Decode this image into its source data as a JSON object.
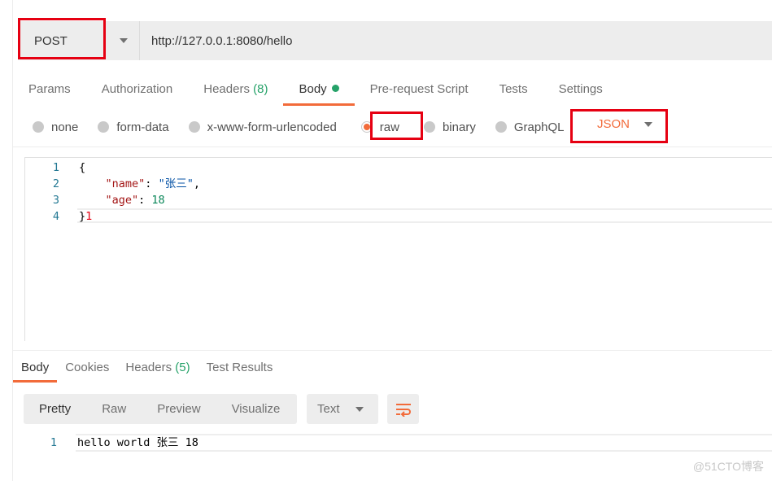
{
  "request": {
    "method": "POST",
    "url": "http://127.0.0.1:8080/hello"
  },
  "tabs": [
    {
      "label": "Params"
    },
    {
      "label": "Authorization"
    },
    {
      "label": "Headers",
      "count": "(8)"
    },
    {
      "label": "Body"
    },
    {
      "label": "Pre-request Script"
    },
    {
      "label": "Tests"
    },
    {
      "label": "Settings"
    }
  ],
  "body_types": [
    {
      "label": "none"
    },
    {
      "label": "form-data"
    },
    {
      "label": "x-www-form-urlencoded"
    },
    {
      "label": "raw"
    },
    {
      "label": "binary"
    },
    {
      "label": "GraphQL"
    }
  ],
  "format": "JSON",
  "editor": {
    "line_numbers": [
      "1",
      "2",
      "3",
      "4"
    ],
    "open_brace": "{",
    "key_name": "\"name\"",
    "val_name": "\"张三\"",
    "key_age": "\"age\"",
    "val_age": "18",
    "close_brace": "}",
    "close_mark": "1"
  },
  "response": {
    "tabs": [
      {
        "label": "Body"
      },
      {
        "label": "Cookies"
      },
      {
        "label": "Headers",
        "count": "(5)"
      },
      {
        "label": "Test Results"
      }
    ],
    "views": [
      "Pretty",
      "Raw",
      "Preview",
      "Visualize"
    ],
    "type": "Text",
    "line_number": "1",
    "text": "hello world 张三 18"
  },
  "watermark": "@51CTO博客",
  "colors": {
    "accent": "#f26b3a",
    "highlight": "#e60012",
    "green": "#26a269"
  }
}
